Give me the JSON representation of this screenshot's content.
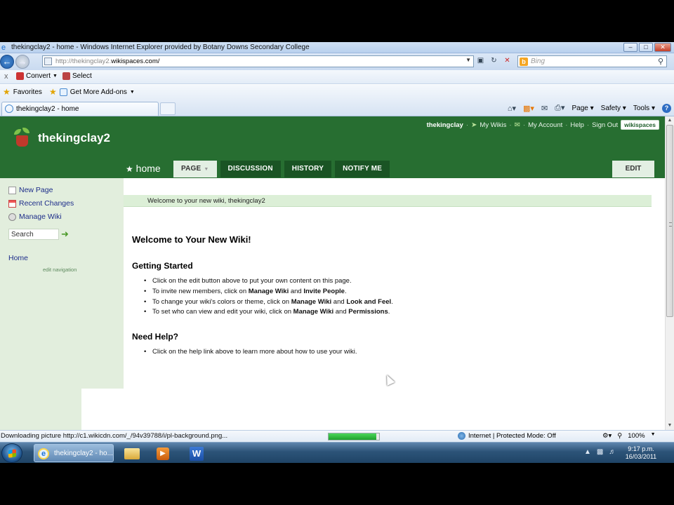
{
  "window": {
    "title": "thekingclay2 - home - Windows Internet Explorer provided by Botany Downs Secondary College",
    "controls": [
      "–",
      "□",
      "✕"
    ]
  },
  "address": {
    "url_prefix": "http://thekingclay2.",
    "url_domain": "wikispaces.com/",
    "search_placeholder": "Bing"
  },
  "convert_bar": {
    "convert_label": "Convert",
    "select_label": "Select"
  },
  "favorites_bar": {
    "favorites_label": "Favorites",
    "addons_label": "Get More Add-ons"
  },
  "tabs_row": {
    "tab_label": "thekingclay2 - home",
    "page_menu": "Page",
    "safety_menu": "Safety",
    "tools_menu": "Tools"
  },
  "wiki": {
    "site_name": "thekingclay2",
    "user": "thekingclay",
    "top_links": {
      "my_wikis": "My Wikis",
      "my_account": "My Account",
      "help": "Help",
      "sign_out": "Sign Out",
      "badge": "wikispaces"
    },
    "page_title": "home",
    "tabs": [
      "PAGE",
      "DISCUSSION",
      "HISTORY",
      "NOTIFY ME"
    ],
    "edit_label": "EDIT",
    "sidebar": {
      "new_page": "New Page",
      "recent_changes": "Recent Changes",
      "manage_wiki": "Manage Wiki",
      "search_placeholder": "Search",
      "home": "Home",
      "edit_navigation": "edit navigation"
    },
    "message": "Welcome to your new wiki, thekingclay2",
    "content": {
      "heading": "Welcome to Your New Wiki!",
      "getting_started": "Getting Started",
      "gs_items": [
        {
          "pre": "Click on the edit button above to put your own content on this page.",
          "b1": "",
          "mid": "",
          "b2": "",
          "post": ""
        },
        {
          "pre": "To invite new members, click on ",
          "b1": "Manage Wiki",
          "mid": " and ",
          "b2": "Invite People",
          "post": "."
        },
        {
          "pre": "To change your wiki's colors or theme, click on ",
          "b1": "Manage Wiki",
          "mid": " and ",
          "b2": "Look and Feel",
          "post": "."
        },
        {
          "pre": "To set who can view and edit your wiki, click on ",
          "b1": "Manage Wiki",
          "mid": " and ",
          "b2": "Permissions",
          "post": "."
        }
      ],
      "need_help": "Need Help?",
      "help_item": "Click on the help link above to learn more about how to use your wiki."
    }
  },
  "status_bar": {
    "downloading": "Downloading picture http://c1.wikicdn.com/_/94v39788/i/pl-background.png...",
    "progress": 0.95,
    "zone": "Internet | Protected Mode: Off",
    "zoom": "100%"
  },
  "taskbar": {
    "ie_label": "thekingclay2 - ho...",
    "word_label": "W",
    "time": "9:17 p.m.",
    "date": "16/03/2011"
  },
  "colors": {
    "wiki_green": "#276e31",
    "tab_dark": "#1a5424",
    "sidebar_bg": "#e2eedd",
    "message_bg": "#dcefd7"
  }
}
